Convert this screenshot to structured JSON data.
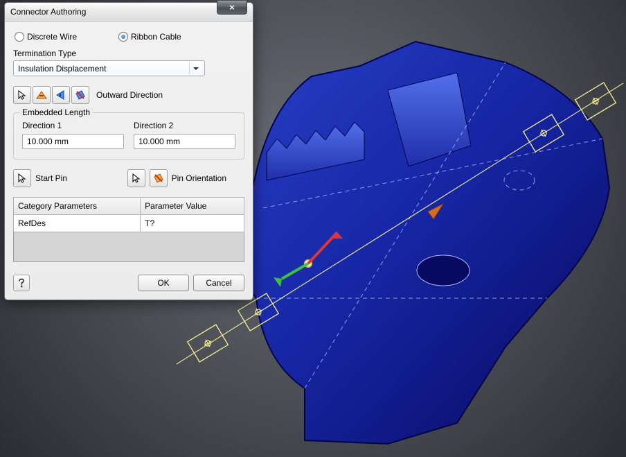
{
  "dialog": {
    "title": "Connector Authoring",
    "radio": {
      "discrete_label": "Discrete Wire",
      "ribbon_label": "Ribbon Cable",
      "discrete_checked": false,
      "ribbon_checked": true
    },
    "termination": {
      "label": "Termination Type",
      "value": "Insulation Displacement"
    },
    "outward_label": "Outward Direction",
    "embedded_length": {
      "legend": "Embedded Length",
      "dir1_label": "Direction 1",
      "dir1_value": "10.000 mm",
      "dir2_label": "Direction 2",
      "dir2_value": "10.000 mm"
    },
    "start_pin_label": "Start Pin",
    "pin_orientation_label": "Pin Orientation",
    "table": {
      "col1": "Category Parameters",
      "col2": "Parameter Value",
      "row1_key": "RefDes",
      "row1_val": "T?"
    },
    "buttons": {
      "ok": "OK",
      "cancel": "Cancel",
      "help": "?"
    }
  },
  "icons": {
    "cursor": "cursor-icon",
    "orient1": "orient-x-icon",
    "orient2": "orient-y-icon",
    "orient3": "orient-z-icon",
    "pin_arrow": "pin-arrow-icon"
  }
}
